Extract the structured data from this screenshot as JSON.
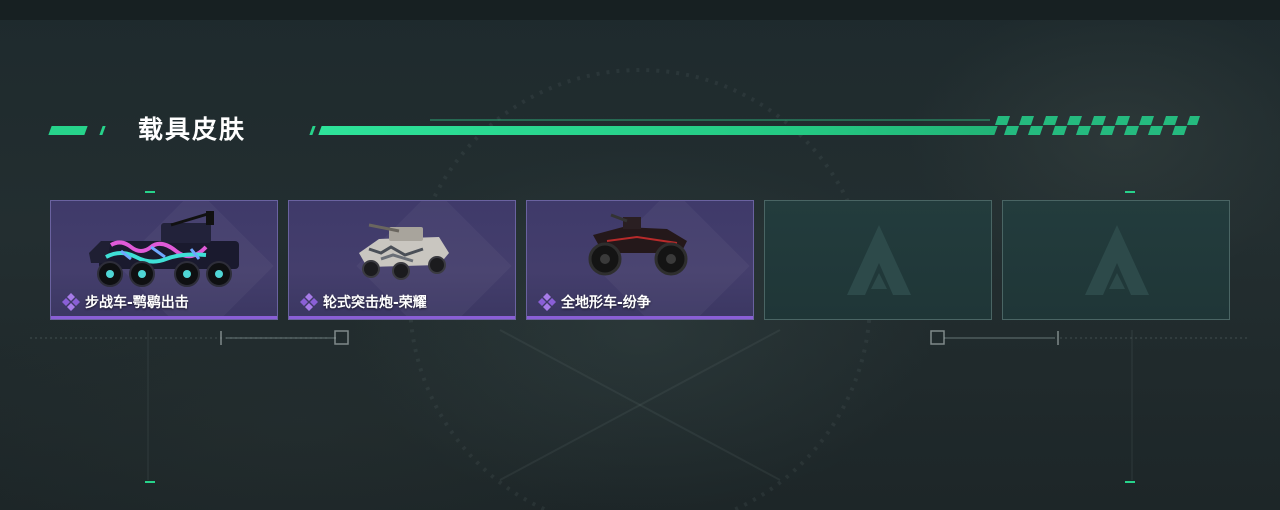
{
  "header": {
    "title": "载具皮肤"
  },
  "skins": [
    {
      "label": "步战车-鹗鹖出击",
      "vehicle_icon": "ifv-graffiti-icon",
      "rarity_icon": "purple-diamond-icon",
      "rarity_color": "#9b6de0"
    },
    {
      "label": "轮式突击炮-荣耀",
      "vehicle_icon": "wheeled-assault-gun-icon",
      "rarity_icon": "purple-diamond-icon",
      "rarity_color": "#9b6de0"
    },
    {
      "label": "全地形车-纷争",
      "vehicle_icon": "atv-icon",
      "rarity_icon": "purple-diamond-icon",
      "rarity_color": "#9b6de0"
    },
    {
      "label": "",
      "placeholder_icon": "delta-logo-icon"
    },
    {
      "label": "",
      "placeholder_icon": "delta-logo-icon"
    }
  ],
  "colors": {
    "accent": "#27d38b",
    "rarity_purple": "#8a5fd6",
    "card_purple": "#443e6c",
    "card_empty": "#213a3b"
  }
}
